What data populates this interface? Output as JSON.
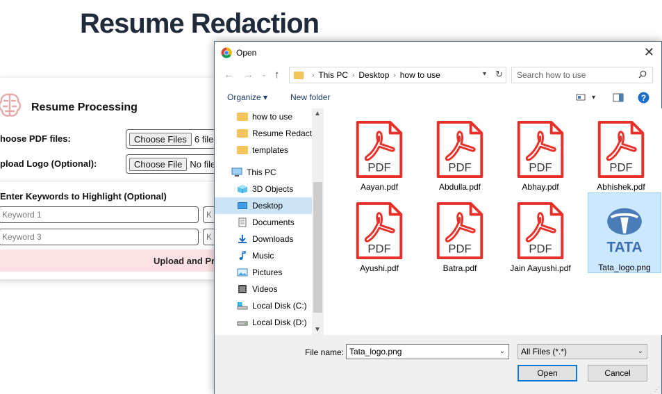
{
  "page": {
    "title": "Resume Redaction",
    "section_heading": "Resume Processing",
    "pdf_label": "hoose PDF files:",
    "pdf_button": "Choose Files",
    "pdf_status": "6 files",
    "logo_label": "pload Logo (Optional):",
    "logo_button": "Choose File",
    "logo_status": "No file",
    "keywords_heading": "Enter Keywords to Highlight (Optional)",
    "keyword1_placeholder": "Keyword 1",
    "keyword2_placeholder": "K",
    "keyword3_placeholder": "Keyword 3",
    "keyword4_placeholder": "K",
    "upload_button": "Upload and Pr"
  },
  "dialog": {
    "title": "Open",
    "close_glyph": "✕",
    "breadcrumb": [
      "This PC",
      "Desktop",
      "how to use"
    ],
    "search_placeholder": "Search how to use",
    "organize_label": "Organize ▾",
    "new_folder_label": "New folder",
    "nav": [
      {
        "label": "how to use",
        "icon": "folder-icon"
      },
      {
        "label": "Resume Redactc",
        "icon": "folder-icon"
      },
      {
        "label": "templates",
        "icon": "folder-icon"
      },
      {
        "label": "This PC",
        "icon": "computer-icon"
      },
      {
        "label": "3D Objects",
        "icon": "cube-icon"
      },
      {
        "label": "Desktop",
        "icon": "desktop-icon"
      },
      {
        "label": "Documents",
        "icon": "document-icon"
      },
      {
        "label": "Downloads",
        "icon": "download-icon"
      },
      {
        "label": "Music",
        "icon": "music-icon"
      },
      {
        "label": "Pictures",
        "icon": "picture-icon"
      },
      {
        "label": "Videos",
        "icon": "video-icon"
      },
      {
        "label": "Local Disk (C:)",
        "icon": "drive-icon"
      },
      {
        "label": "Local Disk (D:)",
        "icon": "drive-icon"
      }
    ],
    "files": [
      {
        "name": "Aayan.pdf",
        "type": "pdf"
      },
      {
        "name": "Abdulla.pdf",
        "type": "pdf"
      },
      {
        "name": "Abhay.pdf",
        "type": "pdf"
      },
      {
        "name": "Abhishek.pdf",
        "type": "pdf"
      },
      {
        "name": "Ayushi.pdf",
        "type": "pdf"
      },
      {
        "name": "Batra.pdf",
        "type": "pdf"
      },
      {
        "name": "Jain Aayushi.pdf",
        "type": "pdf"
      },
      {
        "name": "Tata_logo.png",
        "type": "png"
      }
    ],
    "pdf_badge": "PDF",
    "tata_text": "TATA",
    "filename_label": "File name:",
    "filename_value": "Tata_logo.png",
    "filetype_value": "All Files (*.*)",
    "open_label": "Open",
    "cancel_label": "Cancel",
    "colors": {
      "accent": "#0078d7",
      "pdf_red": "#e8302a",
      "selection": "#cce8ff",
      "folder": "#f2c45a"
    }
  }
}
